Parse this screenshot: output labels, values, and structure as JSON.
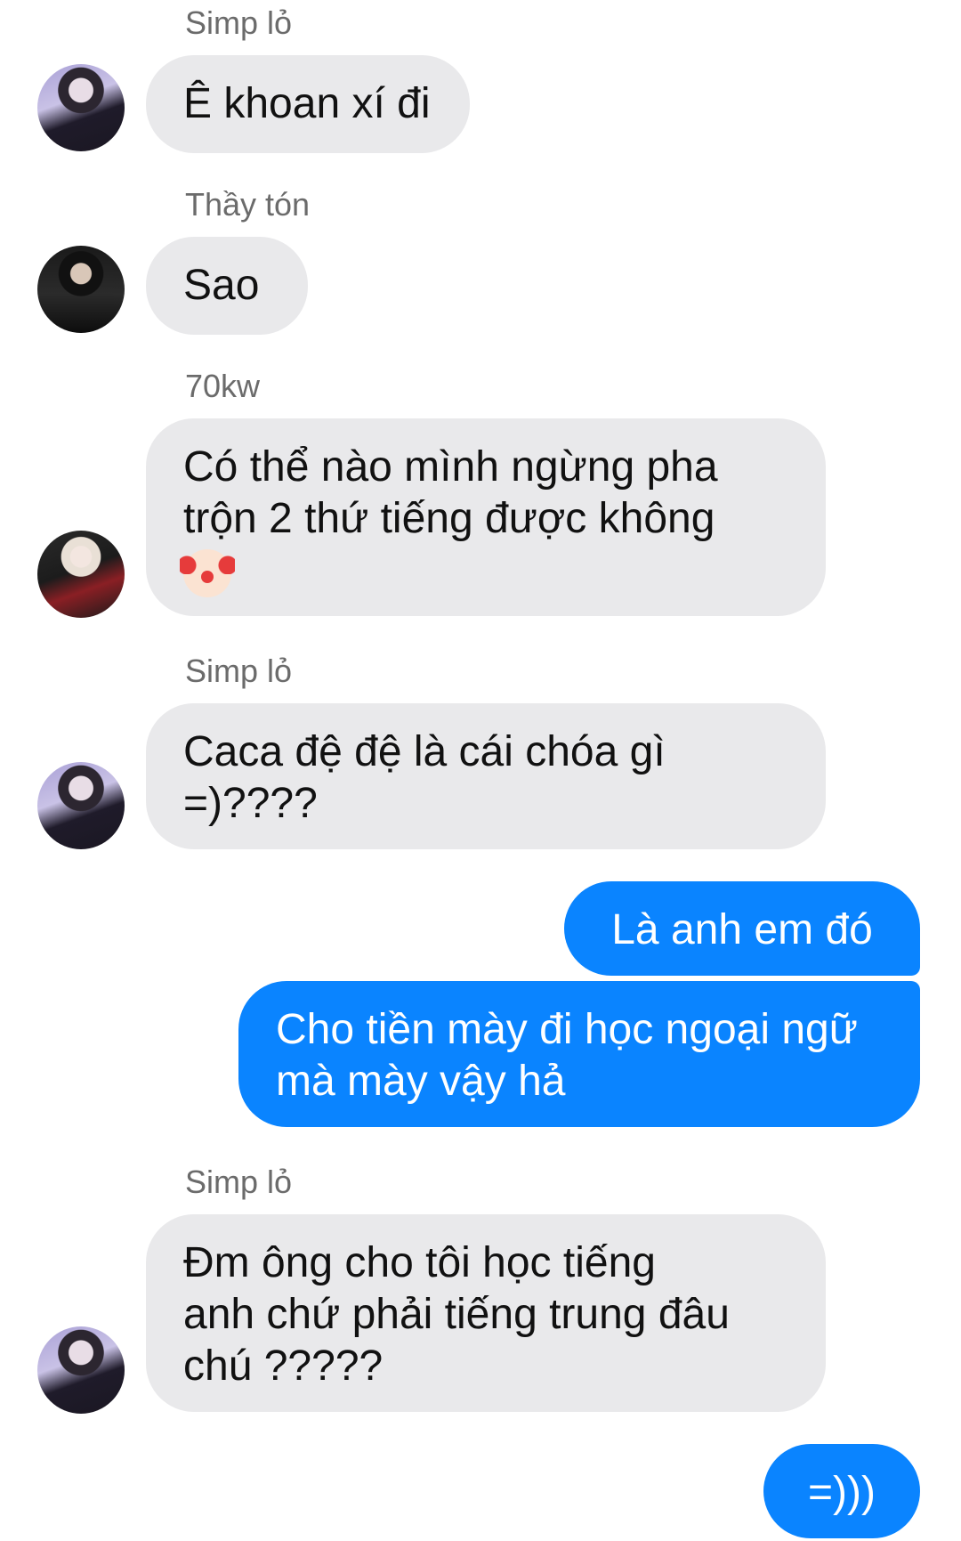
{
  "messages": [
    {
      "sender": "Simp lỏ",
      "lines": [
        "Ê khoan xí đi"
      ],
      "avatar": "avatar-simp-lo"
    },
    {
      "sender": "Thầy tón",
      "lines": [
        "Sao"
      ],
      "avatar": "avatar-thay-ton"
    },
    {
      "sender": "70kw",
      "lines": [
        "Có thể nào mình ngừng pha",
        "trộn 2 thứ tiếng được không"
      ],
      "emoji": "clown-face-icon",
      "avatar": "avatar-70kw"
    },
    {
      "sender": "Simp lỏ",
      "lines": [
        "Caca đệ đệ là cái chóa gì",
        "=)????"
      ],
      "avatar": "avatar-simp-lo"
    },
    {
      "outgoing": true,
      "lines": [
        "Là anh em đó"
      ]
    },
    {
      "outgoing": true,
      "lines": [
        "Cho tiền mày đi học ngoại ngữ",
        "mà mày vậy hả"
      ]
    },
    {
      "sender": "Simp lỏ",
      "lines": [
        "Đm ông cho tôi học tiếng",
        "anh chứ phải tiếng trung đâu",
        "chú ?????"
      ],
      "avatar": "avatar-simp-lo"
    },
    {
      "outgoing": true,
      "lines": [
        "=)))"
      ]
    }
  ],
  "colors": {
    "incoming_bubble": "#e9e9eb",
    "outgoing_bubble": "#0a84ff",
    "sender_name": "#6b6b6b"
  }
}
